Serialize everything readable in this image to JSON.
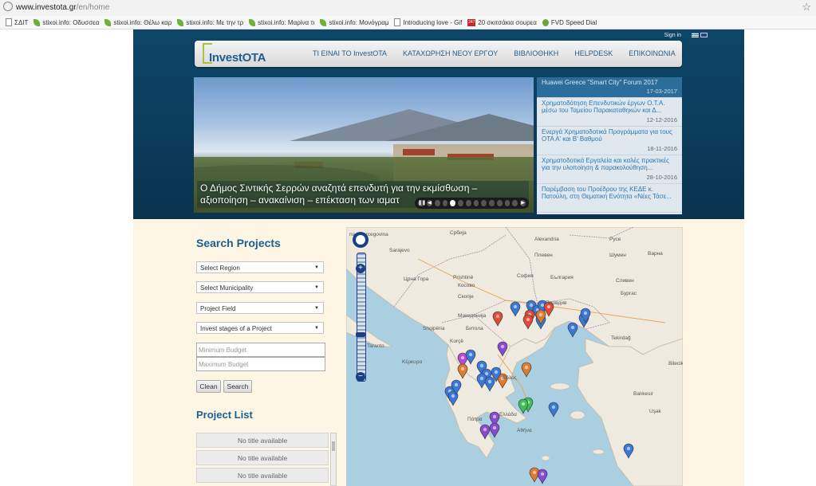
{
  "browser": {
    "url_host": "www.investota.gr",
    "url_path": "/en/home",
    "bookmarks": [
      {
        "label": "ΣΔΙΤ",
        "icon": "doc"
      },
      {
        "label": "stixoi.info: Οδυσσεα",
        "icon": "leaf"
      },
      {
        "label": "stixoi.info: Θέλω καρ",
        "icon": "leaf"
      },
      {
        "label": "stixoi.info: Με την τρ",
        "icon": "leaf"
      },
      {
        "label": "stixoi.info: Μαρίνα τι",
        "icon": "leaf"
      },
      {
        "label": "stixoi.info: Μονόγραμ",
        "icon": "leaf"
      },
      {
        "label": "Introducing love - Gif",
        "icon": "doc"
      },
      {
        "label": "20 σκιτσάκια σουρεα",
        "icon": "red",
        "icon_text": "247"
      },
      {
        "label": "FVD Speed Dial",
        "icon": "fvd"
      }
    ]
  },
  "header": {
    "signin": "Sign in",
    "logo_text_a": "Invest",
    "logo_text_b": "OTA",
    "nav": [
      "ΤΙ ΕΙΝΑΙ ΤΟ InvestOTA",
      "ΚΑΤΑΧΩΡΗΣΗ ΝΕΟΥ ΕΡΓΟΥ",
      "ΒΙΒΛΙΟΘΗΚΗ",
      "HELPDESK",
      "ΕΠΙΚΟΙΝΩΝΙΑ"
    ]
  },
  "slider": {
    "caption": "Ο Δήμος Σιντικής Σερρών αναζητά επενδυτή για την εκμίσθωση – αξιοποίηση – ανακαίνιση – επέκταση των ιαματ",
    "slide_count": 11,
    "active_slide": 2
  },
  "news": [
    {
      "title": "Huawei Greece \"Smart City\" Forum 2017",
      "date": "17-03-2017"
    },
    {
      "title": "Χρηματοδότηση Επενδυτικών έργων Ο.Τ.Α. μέσω του Ταμείου Παρακαταθηκών και Δ...",
      "date": "12-12-2016"
    },
    {
      "title": "Ενεργά Χρηματοδοτικά Προγράμματα για τους ΟΤΑ Α' και Β' Βαθμού",
      "date": "18-11-2016"
    },
    {
      "title": "Χρηματοδοτικά Εργαλεία και καλές πρακτικές για την υλοποίηση & παρακολούθηση...",
      "date": "28-10-2016"
    },
    {
      "title": "Παρέμβαση του Προέδρου της ΚΕΔΕ κ. Πατούλη, στη Θεματική Ενότητα «Νέες Τάσε...",
      "date": ""
    }
  ],
  "search": {
    "title": "Search Projects",
    "region": "Select Region",
    "municipality": "Select Municipality",
    "field": "Project Field",
    "stages": "Invest stages of a Project",
    "min_budget_placeholder": "Minimum Budget",
    "max_budget_placeholder": "Maximum Budget",
    "clean_label": "Clean",
    "search_label": "Search"
  },
  "project_list": {
    "title": "Project List",
    "items": [
      "No title available",
      "No title available",
      "No title available"
    ]
  },
  "map": {
    "labels": [
      {
        "text": "na i Hercegovina"
      },
      {
        "text": "Србија"
      },
      {
        "text": "Sarajevo"
      },
      {
        "text": "Alexandria"
      },
      {
        "text": "Ρусе"
      },
      {
        "text": "Плевен"
      },
      {
        "text": "Шумен"
      },
      {
        "text": "Варна"
      },
      {
        "text": "Prishtinë"
      },
      {
        "text": "София"
      },
      {
        "text": "Црна Гора"
      },
      {
        "text": "Косово"
      },
      {
        "text": "България"
      },
      {
        "text": "Сливен"
      },
      {
        "text": "Бургас"
      },
      {
        "text": "Скопје"
      },
      {
        "text": "Пловдив"
      },
      {
        "text": "Македонија"
      },
      {
        "text": "Shqipëria"
      },
      {
        "text": "Битола"
      },
      {
        "text": "Tekirdağ"
      },
      {
        "text": "Taranto"
      },
      {
        "text": "Korçë"
      },
      {
        "text": "Κέρκυρα"
      },
      {
        "text": "Βόλος"
      },
      {
        "text": "Ελλάδα"
      },
      {
        "text": "Πάτρα"
      },
      {
        "text": "Αθήνα"
      },
      {
        "text": "Bilecik"
      },
      {
        "text": "Uşak"
      },
      {
        "text": "Balıkesir"
      }
    ],
    "markers": [
      {
        "color": "#3a78d8"
      },
      {
        "color": "#3a78d8"
      },
      {
        "color": "#3a78d8"
      },
      {
        "color": "#3a78d8"
      },
      {
        "color": "#e04a36"
      },
      {
        "color": "#e04a36"
      },
      {
        "color": "#3a78d8"
      },
      {
        "color": "#e07a2e"
      },
      {
        "color": "#e04a36"
      },
      {
        "color": "#3a78d8"
      },
      {
        "color": "#3a78d8"
      },
      {
        "color": "#3a78d8"
      },
      {
        "color": "#e04a36"
      },
      {
        "color": "#8a4ad0"
      },
      {
        "color": "#b44ad0"
      },
      {
        "color": "#3a78d8"
      },
      {
        "color": "#3a78d8"
      },
      {
        "color": "#e07a2e"
      },
      {
        "color": "#3a78d8"
      },
      {
        "color": "#e07a2e"
      },
      {
        "color": "#3a78d8"
      },
      {
        "color": "#3a78d8"
      },
      {
        "color": "#3a78d8"
      },
      {
        "color": "#3a78d8"
      },
      {
        "color": "#3a78d8"
      },
      {
        "color": "#e07a2e"
      },
      {
        "color": "#3a78d8"
      },
      {
        "color": "#3bbf5a"
      },
      {
        "color": "#3bbf5a"
      },
      {
        "color": "#3a78d8"
      },
      {
        "color": "#8a4ad0"
      },
      {
        "color": "#8a4ad0"
      },
      {
        "color": "#8a4ad0"
      },
      {
        "color": "#3a78d8"
      },
      {
        "color": "#e07a2e"
      },
      {
        "color": "#8a4ad0"
      }
    ]
  },
  "colors": {
    "header_bg": "#0b3a56",
    "brand_blue": "#1d5f92",
    "brand_green": "#a7c53b",
    "page_bg": "#fdf6e4",
    "sea": "#a9cfe0"
  }
}
